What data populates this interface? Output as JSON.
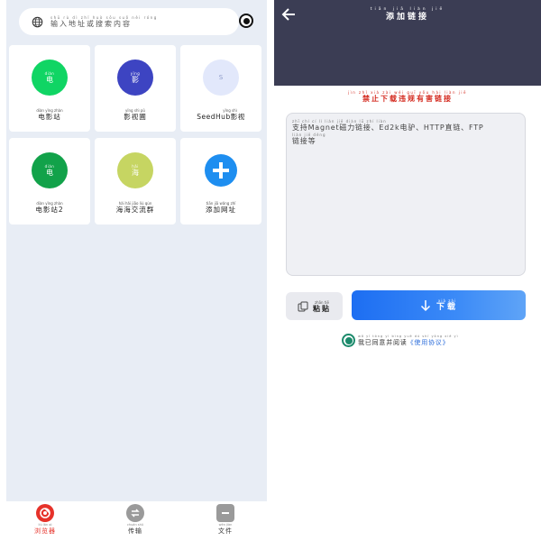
{
  "left": {
    "search": {
      "pinyin": "shū rù dì zhǐ huò sōu suǒ nèi róng",
      "placeholder": "输入地址或搜索内容"
    },
    "tiles": [
      {
        "circle_pinyin": "diàn",
        "circle_char": "电",
        "label_pinyin": "diàn yǐng zhàn",
        "label": "电影站",
        "color": "#10d564",
        "text_color": "#ffffff"
      },
      {
        "circle_pinyin": "yǐng",
        "circle_char": "影",
        "label_pinyin": "yǐng shì pǔ",
        "label": "影视圃",
        "color": "#3d44c2",
        "text_color": "#ffffff"
      },
      {
        "circle_pinyin": "",
        "circle_char": "S",
        "label_pinyin": "yǐng shì",
        "label": "SeedHub影视",
        "color": "#e2e8fb",
        "text_color": "#8d9bc9"
      },
      {
        "circle_pinyin": "diàn",
        "circle_char": "电",
        "label_pinyin": "diàn yǐng zhàn",
        "label": "电影站2",
        "color": "#12a24a",
        "text_color": "#ffffff"
      },
      {
        "circle_pinyin": "hǎi",
        "circle_char": "海",
        "label_pinyin": "hǎi hǎi jiāo liú qún",
        "label": "海海交流群",
        "color": "#c6d562",
        "text_color": "#ffffff"
      },
      {
        "circle_pinyin": "",
        "circle_char": "+",
        "label_pinyin": "tiān jiā wǎng zhǐ",
        "label": "添加网址",
        "color": "#1e8ef0",
        "text_color": "#ffffff"
      }
    ],
    "nav": [
      {
        "pinyin": "liú lǎn qì",
        "label": "浏览器",
        "color": "#e6322a",
        "label_color": "#e6322a",
        "icon": "browser-icon"
      },
      {
        "pinyin": "chuán shū",
        "label": "传输",
        "color": "#9a9a9a",
        "label_color": "#333333",
        "icon": "transfer-icon"
      },
      {
        "pinyin": "wén jiàn",
        "label": "文件",
        "color": "#9a9a9a",
        "label_color": "#333333",
        "icon": "file-icon"
      }
    ]
  },
  "right": {
    "title_pinyin": "tiān jiā liàn jiē",
    "title": "添加链接",
    "warning_pinyin": "jìn zhǐ xià zài wéi guī yǒu hài liàn jiē",
    "warning": "禁止下载违规有害链接",
    "textarea": {
      "pinyin_1": "zhī chí          cí lì liàn jiē   diàn lǘ        zhí liàn",
      "line_1": "支持Magnet磁力链接、Ed2k电驴、HTTP直链、FTP",
      "pinyin_2": "liàn jiē děng",
      "line_2": "链接等"
    },
    "paste": {
      "pinyin": "zhān tiē",
      "label": "粘贴"
    },
    "download": {
      "pinyin": "xià zài",
      "label": "下载"
    },
    "agree": {
      "pinyin": "wǒ yǐ tóng yì bìng yuè dú  shǐ yòng xié yì",
      "text": "我已同意并阅读",
      "link": "《使用协议》"
    }
  }
}
